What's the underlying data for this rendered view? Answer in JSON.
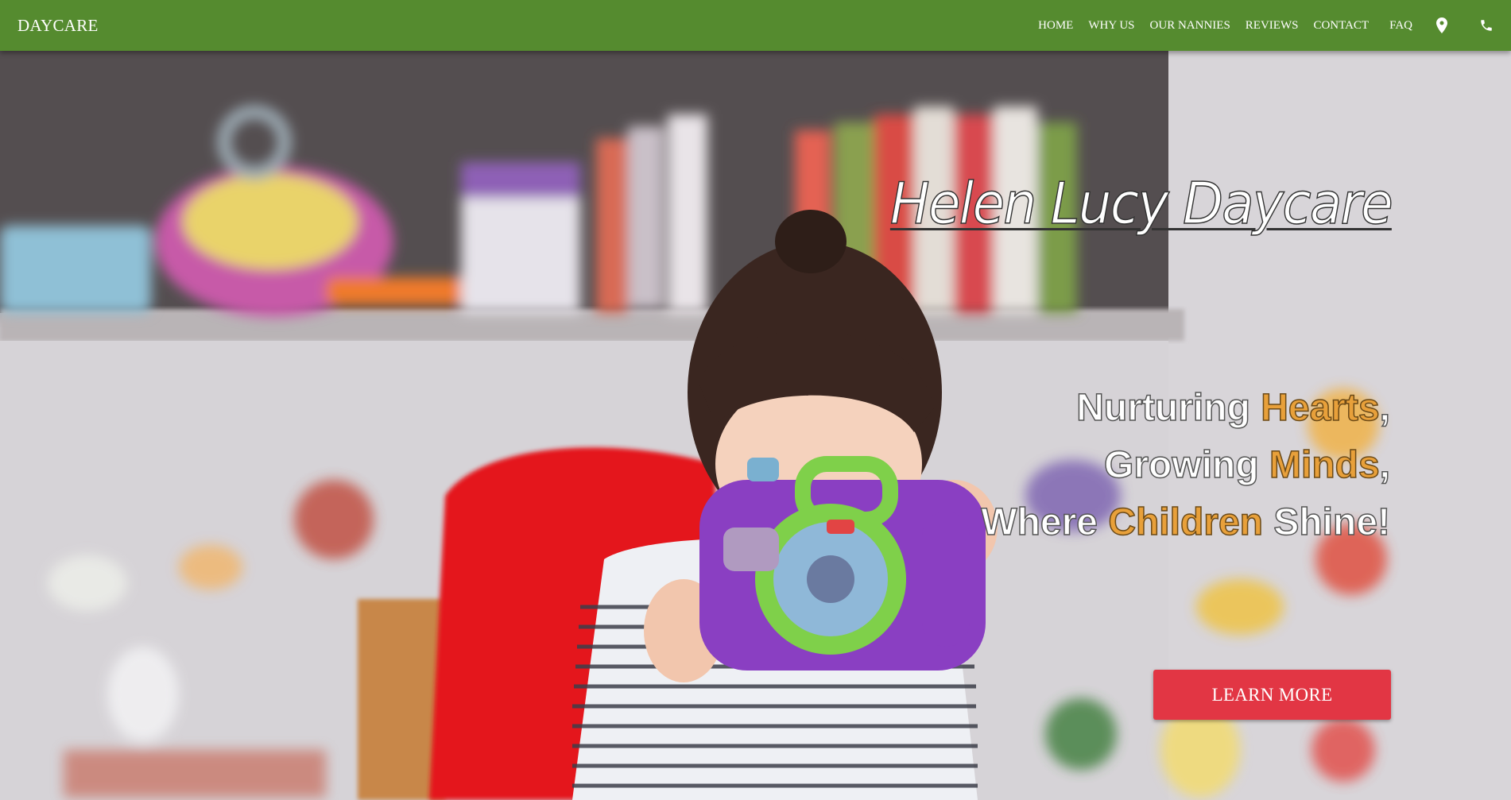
{
  "nav": {
    "brand": "DAYCARE",
    "links": [
      "HOME",
      "WHY US",
      "OUR NANNIES",
      "REVIEWS",
      "CONTACT",
      "FAQ"
    ],
    "icons": [
      "map-marker-icon",
      "phone-icon"
    ]
  },
  "hero": {
    "title": "Helen Lucy Daycare",
    "tagline": {
      "line1_a": "Nurturing ",
      "line1_accent": "Hearts",
      "line1_b": ",",
      "line2_a": "Growing ",
      "line2_accent": "Minds",
      "line2_b": ",",
      "line3_a": "Where ",
      "line3_accent": "Children",
      "line3_b": " Shine!"
    },
    "cta_label": "LEARN MORE"
  },
  "colors": {
    "nav_bg": "#558b2f",
    "accent": "#e8a03a",
    "cta": "#e23644"
  }
}
